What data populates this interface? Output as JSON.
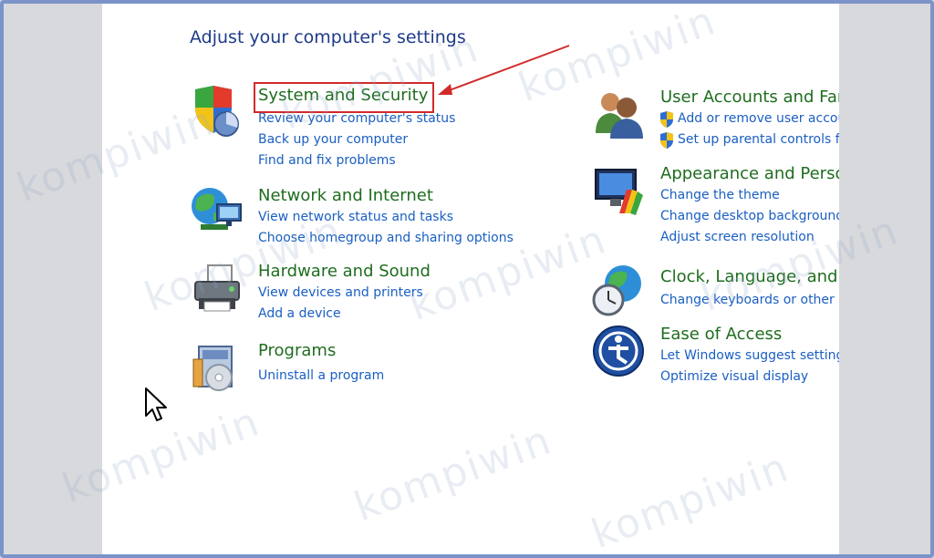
{
  "page": {
    "heading": "Adjust your computer's settings"
  },
  "categories_left": [
    {
      "title": "System and Security",
      "icon": "shield-icon",
      "links": [
        "Review your computer's status",
        "Back up your computer",
        "Find and fix problems"
      ]
    },
    {
      "title": "Network and Internet",
      "icon": "network-icon",
      "links": [
        "View network status and tasks",
        "Choose homegroup and sharing options"
      ]
    },
    {
      "title": "Hardware and Sound",
      "icon": "printer-icon",
      "links": [
        "View devices and printers",
        "Add a device"
      ]
    },
    {
      "title": "Programs",
      "icon": "programs-icon",
      "links": [
        "Uninstall a program"
      ]
    }
  ],
  "categories_right": [
    {
      "title": "User Accounts and Far",
      "icon": "users-icon",
      "links": [
        "Add or remove user accou",
        "Set up parental controls fo"
      ]
    },
    {
      "title": "Appearance and Perso",
      "icon": "appearance-icon",
      "links": [
        "Change the theme",
        "Change desktop background",
        "Adjust screen resolution"
      ]
    },
    {
      "title": "Clock, Language, and I",
      "icon": "clock-globe-icon",
      "links": [
        "Change keyboards or other in"
      ]
    },
    {
      "title": "Ease of Access",
      "icon": "ease-of-access-icon",
      "links": [
        "Let Windows suggest settings",
        "Optimize visual display"
      ]
    }
  ],
  "watermark": "kompiwin",
  "colors": {
    "heading": "#1e3a8a",
    "category_title": "#1f6d1f",
    "link": "#1a5fc2",
    "highlight": "#d12a2a"
  }
}
